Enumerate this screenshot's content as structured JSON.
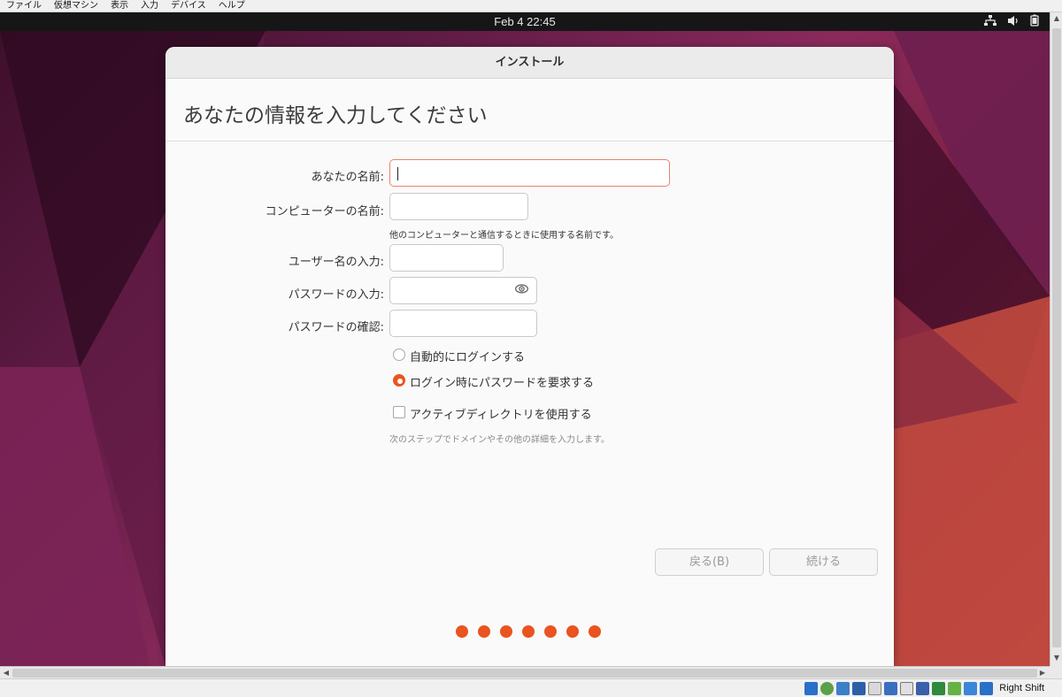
{
  "host_menu": [
    "ファイル",
    "仮想マシン",
    "表示",
    "入力",
    "デバイス",
    "ヘルプ"
  ],
  "topbar": {
    "clock": "Feb 4  22:45"
  },
  "tray_icons": [
    "network-icon",
    "volume-icon",
    "battery-icon"
  ],
  "window": {
    "title": "インストール"
  },
  "page": {
    "heading": "あなたの情報を入力してください"
  },
  "form": {
    "your_name_label": "あなたの名前:",
    "your_name_value": "",
    "computer_name_label": "コンピューターの名前:",
    "computer_name_value": "",
    "computer_name_hint": "他のコンピューターと通信するときに使用する名前です。",
    "username_label": "ユーザー名の入力:",
    "username_value": "",
    "password_label": "パスワードの入力:",
    "password_value": "",
    "confirm_label": "パスワードの確認:",
    "confirm_value": ""
  },
  "login_options": {
    "auto_login": {
      "label": "自動的にログインする",
      "selected": false
    },
    "require_password": {
      "label": "ログイン時にパスワードを要求する",
      "selected": true
    }
  },
  "active_directory": {
    "label": "アクティブディレクトリを使用する",
    "checked": false,
    "hint": "次のステップでドメインやその他の詳細を入力します。"
  },
  "buttons": {
    "back": "戻る(B)",
    "continue": "続ける"
  },
  "progress": {
    "total_steps": 7,
    "color": "#e95420"
  },
  "statusbar": {
    "host_key": "Right Shift"
  },
  "colors": {
    "accent": "#e95420",
    "focus_border": "#e9826b"
  }
}
